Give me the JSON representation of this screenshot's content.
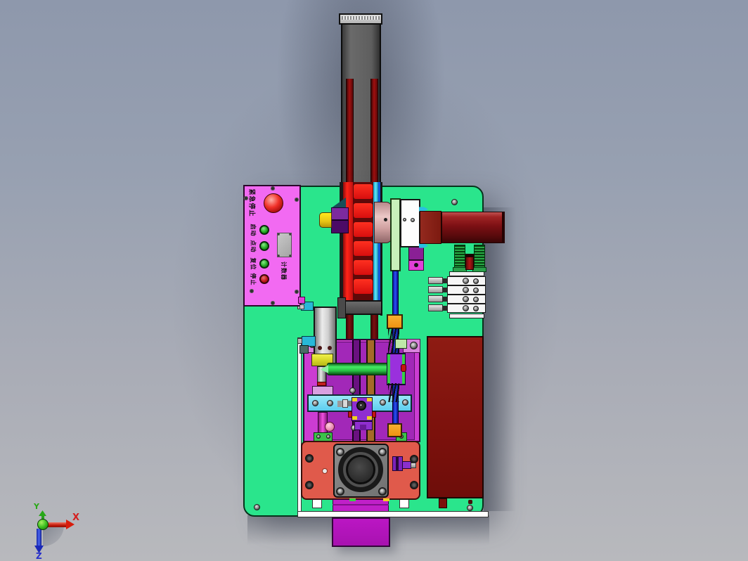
{
  "axis_triad": {
    "x_label": "X",
    "y_label": "Y",
    "z_label": "Z"
  },
  "control_panel": {
    "estop_label": "紧急停止",
    "buttons": [
      {
        "label": "启动",
        "color": "#22aa22"
      },
      {
        "label": "点动",
        "color": "#22aa22"
      },
      {
        "label": "复位",
        "color": "#22aa22"
      },
      {
        "label": "停止",
        "color": "#c01818"
      }
    ],
    "display_label": "计数器"
  },
  "palette": {
    "background_top": "#8e98ac",
    "background_bottom": "#b8b9bd",
    "base_plate_green": "#2ae58c",
    "panel_magenta": "#f26af2",
    "estop_red": "#e02020",
    "fixture_purple": "#cc3cd2",
    "fixture_inner_purple": "#a228b8",
    "belt_bright_red": "#ff2418",
    "pulley_blade_red": "#e01212",
    "motor_dark_red": "#7c1014",
    "side_panel_red": "#8b1a12",
    "chuck_plate_salmon": "#e05a4b",
    "clamp_bar_cyan": "#6ed7f0",
    "guide_rod_blue": "#2a52f8",
    "stopper_orange": "#f59b1b",
    "sensor_yellow": "#ffe81c",
    "workpiece_green": "#28c244",
    "axis_x_color": "#d42020",
    "axis_y_color": "#2aa818",
    "axis_z_color": "#2830cc"
  }
}
